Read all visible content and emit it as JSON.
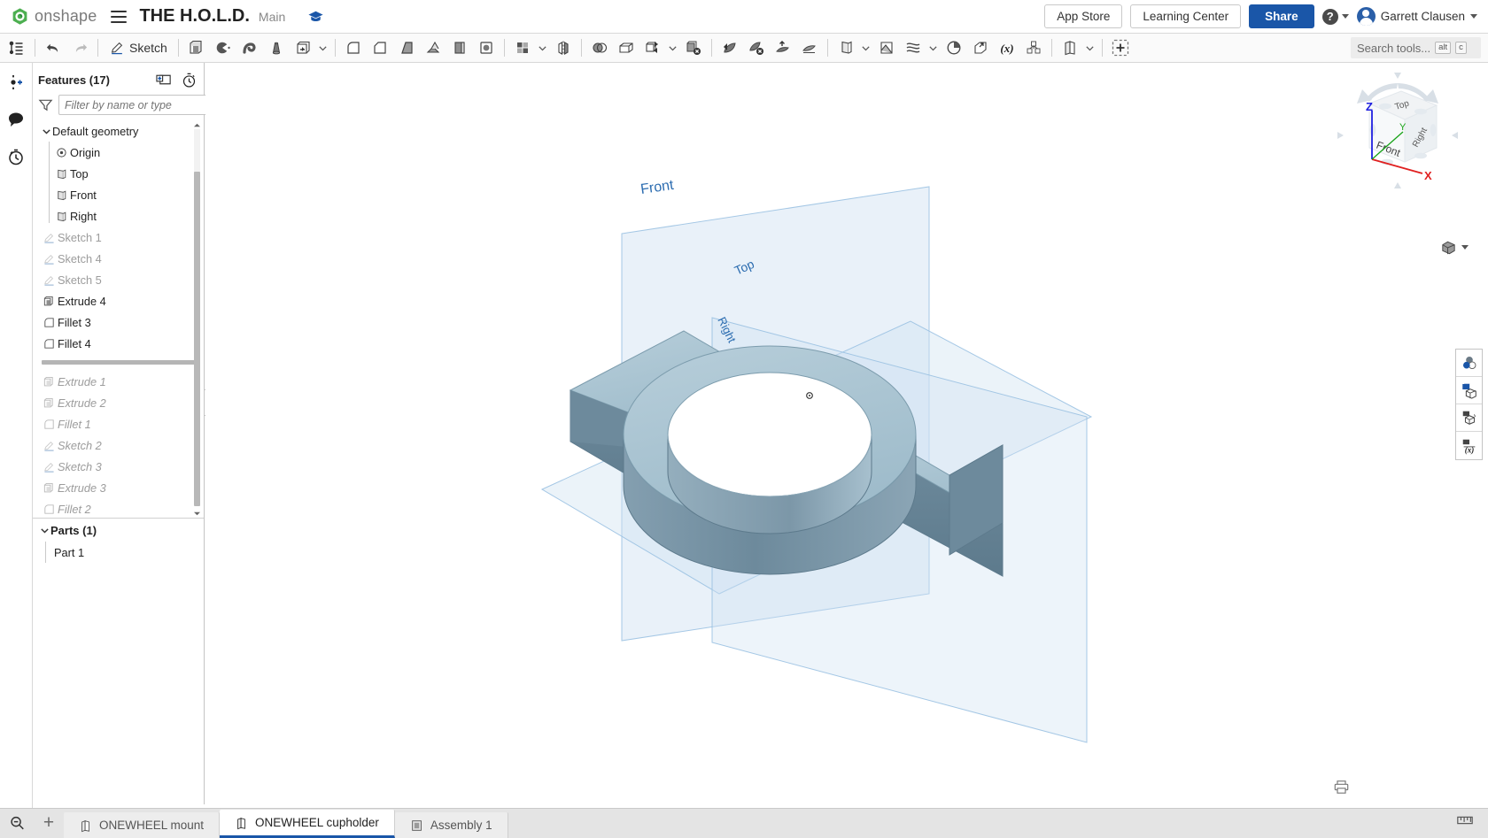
{
  "app": {
    "brand": "onshape",
    "document_title": "THE H.O.L.D.",
    "branch": "Main",
    "menu_icon": "hamburger-icon",
    "graduation_badge": "graduation-cap-icon"
  },
  "topbar": {
    "app_store": "App Store",
    "learning_center": "Learning Center",
    "share": "Share",
    "help": "?",
    "username": "Garrett Clausen"
  },
  "toolbar": {
    "feature_list_icon": "feature-list-icon",
    "undo": "undo-icon",
    "redo": "redo-icon",
    "sketch_label": "Sketch",
    "items": [
      "extrude-icon",
      "revolve-icon",
      "sweep-icon",
      "loft-icon",
      "thicken-icon",
      "fillet-icon",
      "chamfer-icon",
      "draft-icon",
      "rib-icon",
      "shell-icon",
      "hole-icon",
      "linear-pattern-icon",
      "mirror-icon",
      "boolean-icon",
      "enclose-icon",
      "transform-icon",
      "delete-part-icon",
      "split-icon",
      "delete-face-icon",
      "move-face-icon",
      "replace-face-icon",
      "plane-icon",
      "sketch-plane-icon",
      "curve-icon",
      "section-view-icon",
      "import-derived-icon",
      "variable-icon",
      "assembly-icon",
      "composite-part-icon",
      "add-custom-feature-icon"
    ],
    "search_placeholder": "Search tools...",
    "search_shortcut_alt": "alt",
    "search_shortcut_key": "c"
  },
  "left_rail": {
    "items": [
      {
        "name": "insert-feature-icon"
      },
      {
        "name": "comments-icon"
      },
      {
        "name": "history-icon"
      }
    ],
    "bottom_icon": "search-document-icon"
  },
  "feature_panel": {
    "title": "Features (17)",
    "new_folder_icon": "new-folder-icon",
    "rollback_timer_icon": "stopwatch-icon",
    "filter_icon": "filter-icon",
    "filter_placeholder": "Filter by name or type",
    "default_geometry": {
      "label": "Default geometry",
      "children": [
        {
          "label": "Origin",
          "icon": "origin-icon"
        },
        {
          "label": "Top",
          "icon": "plane-icon"
        },
        {
          "label": "Front",
          "icon": "plane-icon"
        },
        {
          "label": "Right",
          "icon": "plane-icon"
        }
      ]
    },
    "features_above_rollback": [
      {
        "label": "Sketch 1",
        "icon": "sketch-icon",
        "state": "dimmed"
      },
      {
        "label": "Sketch 4",
        "icon": "sketch-icon",
        "state": "dimmed"
      },
      {
        "label": "Sketch 5",
        "icon": "sketch-icon",
        "state": "dimmed"
      },
      {
        "label": "Extrude 4",
        "icon": "extrude-icon",
        "state": "active"
      },
      {
        "label": "Fillet 3",
        "icon": "fillet-icon",
        "state": "active"
      },
      {
        "label": "Fillet 4",
        "icon": "fillet-icon",
        "state": "active"
      }
    ],
    "rollback_bar": "rollback-bar",
    "features_below_rollback": [
      {
        "label": "Extrude 1",
        "icon": "extrude-icon",
        "state": "rolled-back"
      },
      {
        "label": "Extrude 2",
        "icon": "extrude-icon",
        "state": "rolled-back"
      },
      {
        "label": "Fillet 1",
        "icon": "fillet-icon",
        "state": "rolled-back"
      },
      {
        "label": "Sketch 2",
        "icon": "sketch-icon",
        "state": "rolled-back"
      },
      {
        "label": "Sketch 3",
        "icon": "sketch-icon",
        "state": "rolled-back"
      },
      {
        "label": "Extrude 3",
        "icon": "extrude-icon",
        "state": "rolled-back"
      },
      {
        "label": "Fillet 2",
        "icon": "fillet-icon",
        "state": "rolled-back"
      }
    ],
    "parts": {
      "title": "Parts (1)",
      "items": [
        {
          "label": "Part 1"
        }
      ]
    },
    "flyout_icon": "panel-flyout-icon"
  },
  "graphics": {
    "view_cube": {
      "top_face": "Top",
      "front_face": "Front",
      "right_face": "Right",
      "axis_x": "X",
      "axis_y": "Y",
      "axis_z": "Z",
      "axis_x_color": "#e02020",
      "axis_y_color": "#17a317",
      "axis_z_color": "#2020e0"
    },
    "planes": [
      {
        "label": "Front",
        "color": "#2b6cb0"
      },
      {
        "label": "Top",
        "color": "#2b6cb0"
      },
      {
        "label": "Right",
        "color": "#2b6cb0"
      }
    ],
    "display_mode_icon": "shaded-display-icon",
    "part_color_top": "#a8c4d6",
    "part_color_side": "#6f8c9e",
    "part_color_inner": "#7e9cae",
    "right_dock": [
      {
        "name": "appearance-icon"
      },
      {
        "name": "display-state-icon"
      },
      {
        "name": "render-icon"
      },
      {
        "name": "measure-icon"
      }
    ]
  },
  "bottom": {
    "search_icon": "document-search-icon",
    "add_tab": "+",
    "tabs": [
      {
        "label": "ONEWHEEL mount",
        "icon": "part-studio-icon",
        "active": false
      },
      {
        "label": "ONEWHEEL cupholder",
        "icon": "part-studio-icon",
        "active": true
      },
      {
        "label": "Assembly 1",
        "icon": "assembly-icon",
        "active": false
      }
    ],
    "right_icons": [
      {
        "name": "print-icon"
      },
      {
        "name": "units-icon"
      }
    ]
  }
}
